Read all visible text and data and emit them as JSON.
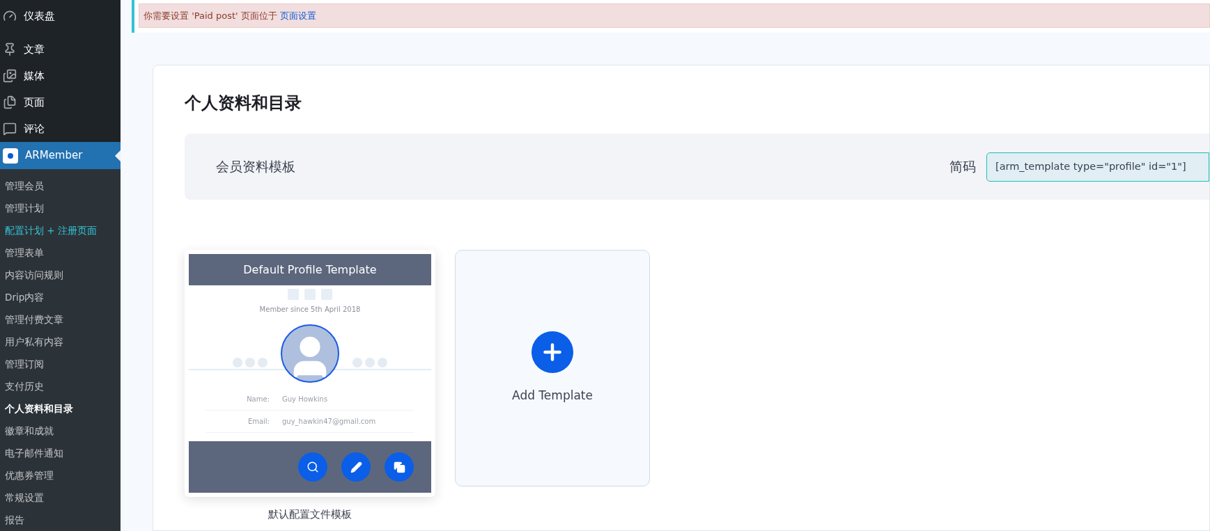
{
  "sidebar": {
    "top_items": [
      {
        "label": "仪表盘",
        "kind": "gauge"
      },
      {
        "label": "文章",
        "kind": "pin"
      },
      {
        "label": "媒体",
        "kind": "media"
      },
      {
        "label": "页面",
        "kind": "pages"
      },
      {
        "label": "评论",
        "kind": "comment"
      }
    ],
    "plugin": {
      "label": "ARMember",
      "expanded": true
    },
    "sub_items": [
      {
        "label": "管理会员",
        "selected": false,
        "hovered": false
      },
      {
        "label": "管理计划",
        "selected": false,
        "hovered": false
      },
      {
        "label": "配置计划 + 注册页面",
        "selected": false,
        "hovered": true
      },
      {
        "label": "管理表单",
        "selected": false,
        "hovered": false
      },
      {
        "label": "内容访问规则",
        "selected": false,
        "hovered": false
      },
      {
        "label": "Drip内容",
        "selected": false,
        "hovered": false
      },
      {
        "label": "管理付费文章",
        "selected": false,
        "hovered": false
      },
      {
        "label": "用户私有内容",
        "selected": false,
        "hovered": false
      },
      {
        "label": "管理订阅",
        "selected": false,
        "hovered": false
      },
      {
        "label": "支付历史",
        "selected": false,
        "hovered": false
      },
      {
        "label": "个人资料和目录",
        "selected": true,
        "hovered": false
      },
      {
        "label": "徽章和成就",
        "selected": false,
        "hovered": false
      },
      {
        "label": "电子邮件通知",
        "selected": false,
        "hovered": false
      },
      {
        "label": "优惠券管理",
        "selected": false,
        "hovered": false
      },
      {
        "label": "常规设置",
        "selected": false,
        "hovered": false
      },
      {
        "label": "报告",
        "selected": false,
        "hovered": false
      }
    ]
  },
  "notice": {
    "text": "你需要设置 'Paid post' 页面位于",
    "link": "页面设置"
  },
  "page_title": "个人资料和目录",
  "section": {
    "label": "会员资料模板",
    "shortcode_label": "简码",
    "shortcode": "[arm_template type=\"profile\" id=\"1\"]"
  },
  "templates": [
    {
      "overlay_title": "Default Profile Template",
      "member_since": "Member since 5th April 2018",
      "fields": [
        {
          "label": "Name:",
          "value": "Guy Howkins"
        },
        {
          "label": "Email:",
          "value": "guy_hawkin47@gmail.com"
        }
      ],
      "caption": "默认配置文件模板"
    }
  ],
  "add_template": {
    "label": "Add Template"
  }
}
